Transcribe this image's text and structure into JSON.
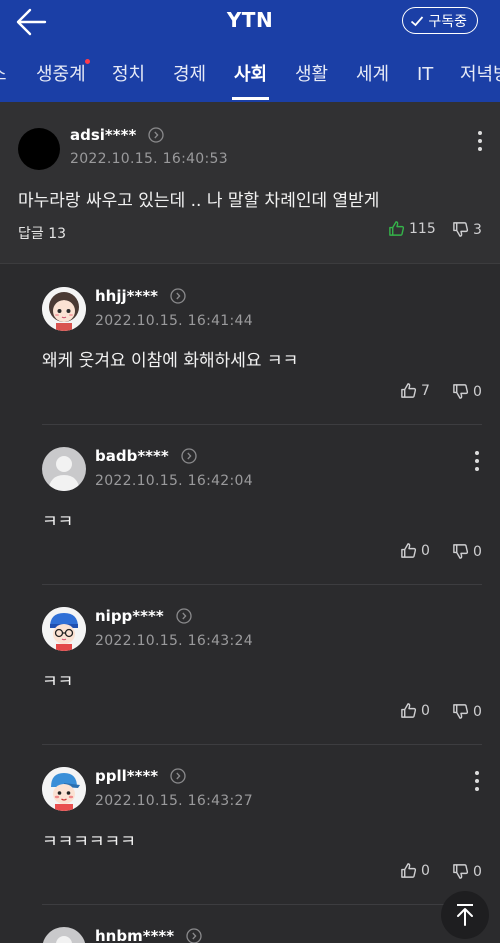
{
  "header": {
    "title": "YTN",
    "subscribe_label": "구독중"
  },
  "tabs": [
    {
      "label": "스"
    },
    {
      "label": "생중계"
    },
    {
      "label": "정치"
    },
    {
      "label": "경제"
    },
    {
      "label": "사회",
      "active": true
    },
    {
      "label": "생활"
    },
    {
      "label": "세계"
    },
    {
      "label": "IT"
    },
    {
      "label": "저녁방"
    }
  ],
  "main_comment": {
    "username": "adsi****",
    "date": "2022.10.15. 16:40:53",
    "text": "마누라랑 싸우고 있는데 .. 나 말할 차례인데 열받게",
    "reply_label": "답글 13",
    "likes": "115",
    "dislikes": "3"
  },
  "replies": [
    {
      "username": "hhjj****",
      "date": "2022.10.15. 16:41:44",
      "text": "왜케 웃겨요 이참에 화해하세요 ㅋㅋ",
      "likes": "7",
      "dislikes": "0"
    },
    {
      "username": "badb****",
      "date": "2022.10.15. 16:42:04",
      "text": "ㅋㅋ",
      "likes": "0",
      "dislikes": "0"
    },
    {
      "username": "nipp****",
      "date": "2022.10.15. 16:43:24",
      "text": "ㅋㅋ",
      "likes": "0",
      "dislikes": "0"
    },
    {
      "username": "ppll****",
      "date": "2022.10.15. 16:43:27",
      "text": "ㅋㅋㅋㅋㅋㅋ",
      "likes": "0",
      "dislikes": "0"
    },
    {
      "username": "hnbm****"
    }
  ],
  "colors": {
    "brand_blue": "#1b3fa6",
    "like_green": "#35b34a",
    "background": "#2b2b2d"
  }
}
